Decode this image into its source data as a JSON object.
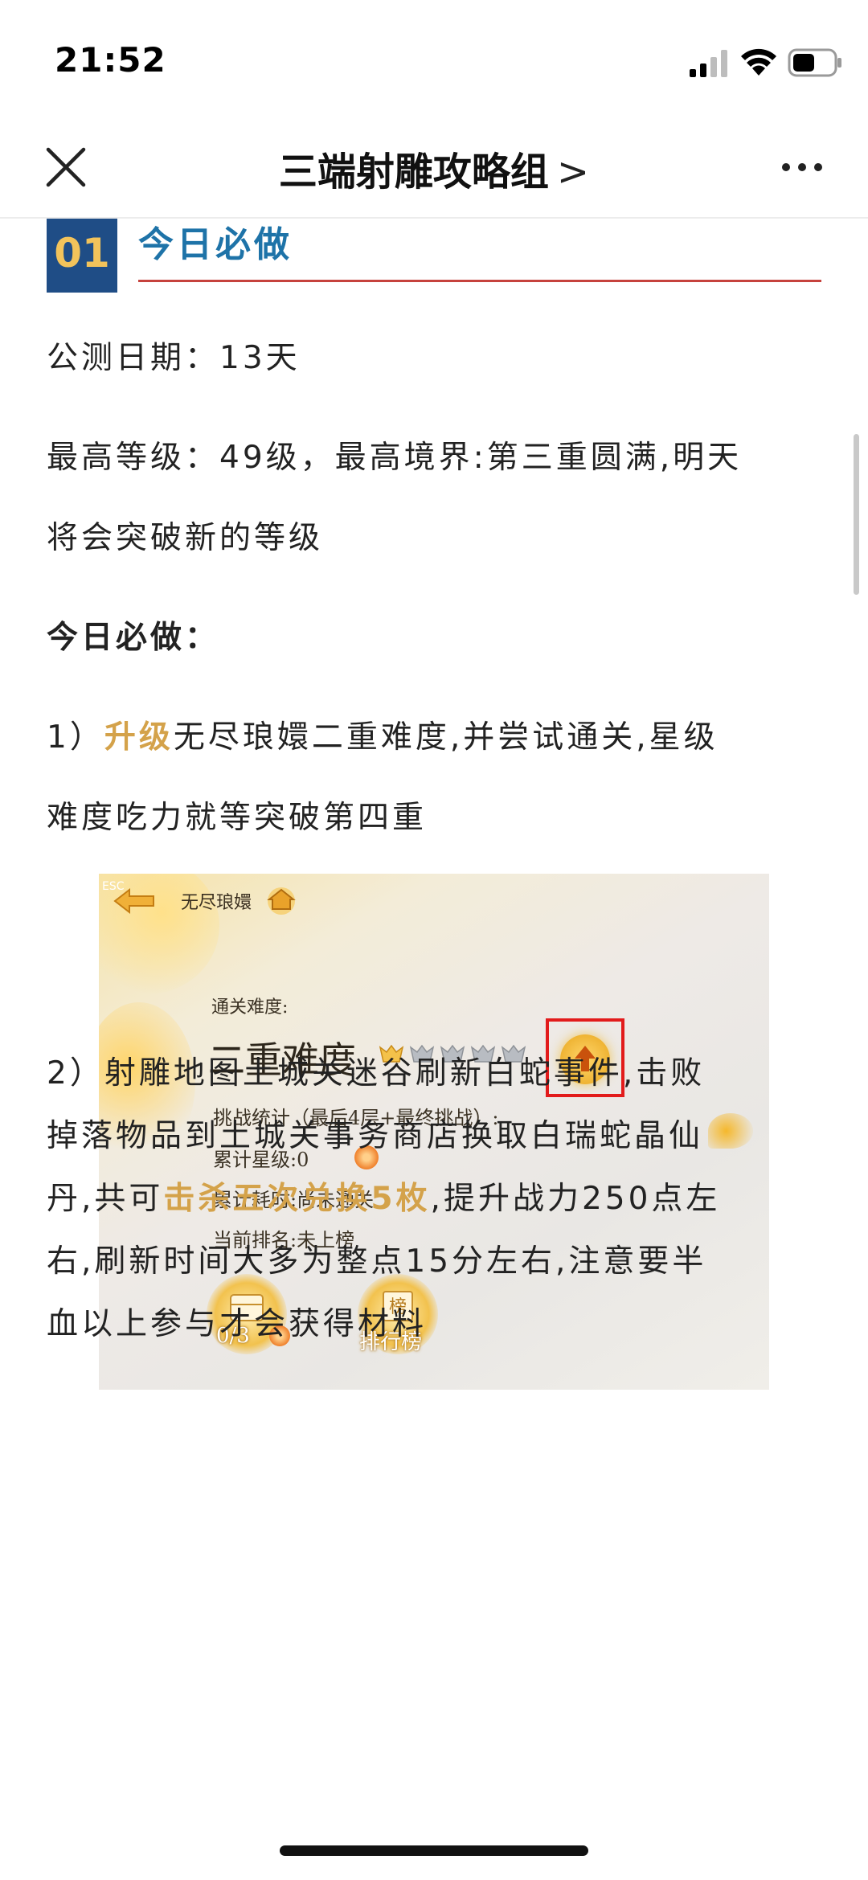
{
  "status_bar": {
    "time": "21:52",
    "icons": [
      "signal-icon",
      "wifi-icon",
      "battery-icon"
    ]
  },
  "nav": {
    "title": "三端射雕攻略组",
    "chevron": ">",
    "icons": [
      "close-icon",
      "more-icon"
    ]
  },
  "section": {
    "number": "01",
    "title": "今日必做"
  },
  "paragraphs": {
    "test_days": "公测日期：13天",
    "max_level_line1": "最高等级：49级，最高境界:第三重圆满,明天",
    "max_level_line2": "将会突破新的等级",
    "todo_heading": "今日必做：",
    "item1_prefix": "1）",
    "item1_highlight": "升级",
    "item1_rest": "无尽琅嬛二重难度,并尝试通关,星级",
    "item1_line2": "难度吃力就等突破第四重",
    "item2_line1": "2）射雕地图土城关迷谷刷新白蛇事件,击败",
    "item2_line2": "掉落物品到土城关事务商店换取白瑞蛇晶仙",
    "item2_line3_prefix": "丹,共可",
    "item2_line3_highlight": "击杀五次兑换5枚",
    "item2_line3_rest": ",提升战力250点左",
    "item2_line4": "右,刷新时间大多为整点15分左右,注意要半",
    "item2_line5": "血以上参与才会获得材料"
  },
  "game_screenshot": {
    "esc": "ESC",
    "title": "无尽琅嬛",
    "difficulty_label": "通关难度:",
    "difficulty": "二重难度",
    "stars_total": 5,
    "stars_lit": 1,
    "stats_title": "挑战统计（最后4层+最终挑战）:",
    "stars_label": "累计星级:0",
    "time_label": "累计耗时:尚未通关",
    "rank_label": "当前排名:未上榜",
    "chest_count": "0/3",
    "leaderboard_icon_char": "榜",
    "leaderboard_label": "排行榜",
    "highlight_color": "#e21b1b"
  },
  "colors": {
    "section_bg": "#1f4d86",
    "section_num": "#f2c35b",
    "section_title": "#1e73a8",
    "section_rule": "#c6423d",
    "highlight_gold": "#d4a24a"
  }
}
